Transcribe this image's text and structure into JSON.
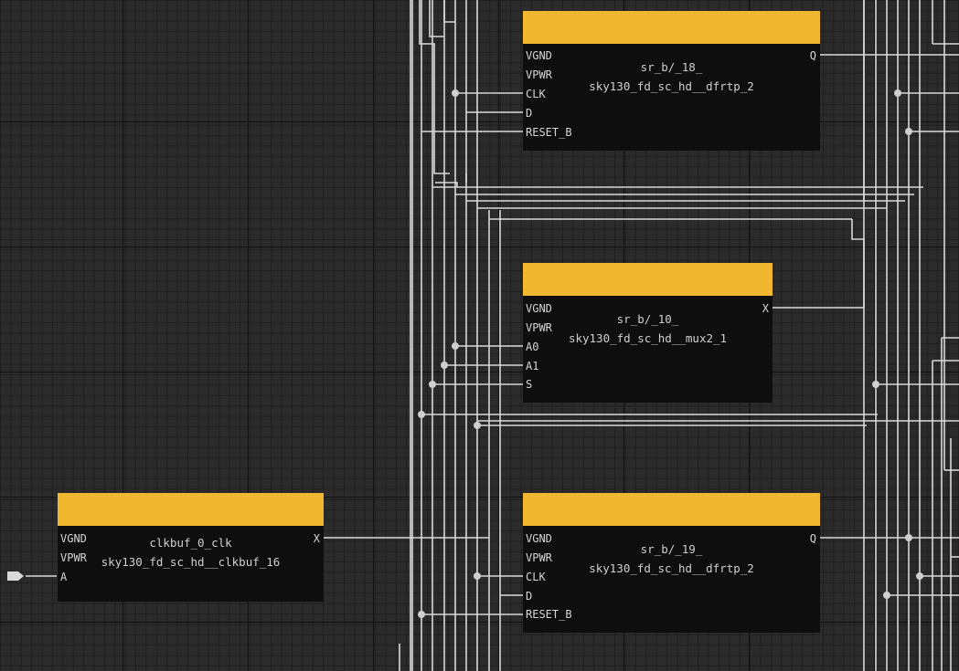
{
  "cells": [
    {
      "id": "sr_b_18",
      "name": "sr_b/_18_",
      "type": "sky130_fd_sc_hd__dfrtp_2",
      "inputs": [
        "VGND",
        "VPWR",
        "CLK",
        "D",
        "RESET_B"
      ],
      "output": "Q"
    },
    {
      "id": "sr_b_10",
      "name": "sr_b/_10_",
      "type": "sky130_fd_sc_hd__mux2_1",
      "inputs": [
        "VGND",
        "VPWR",
        "A0",
        "A1",
        "S"
      ],
      "output": "X"
    },
    {
      "id": "sr_b_19",
      "name": "sr_b/_19_",
      "type": "sky130_fd_sc_hd__dfrtp_2",
      "inputs": [
        "VGND",
        "VPWR",
        "CLK",
        "D",
        "RESET_B"
      ],
      "output": "Q"
    },
    {
      "id": "clkbuf",
      "name": "clkbuf_0_clk",
      "type": "sky130_fd_sc_hd__clkbuf_16",
      "inputs": [
        "VGND",
        "VPWR",
        "A"
      ],
      "output": "X"
    }
  ],
  "colors": {
    "header": "#f0b72f",
    "body": "#0e0e0e",
    "wire": "#d9d9d9",
    "grid_major": "#111111",
    "grid_minor": "#1f1f1f"
  }
}
